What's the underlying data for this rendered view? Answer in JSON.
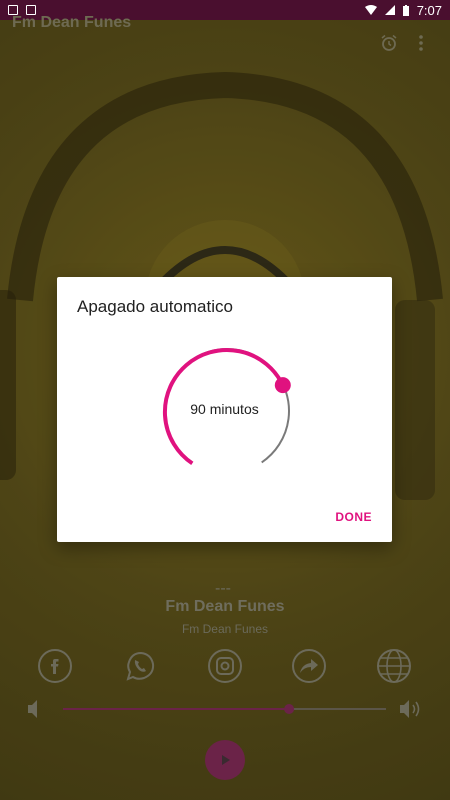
{
  "status_bar": {
    "time": "7:07",
    "left_icons": [
      "image-icon",
      "a-icon"
    ],
    "right_icons": [
      "wifi-icon",
      "signal-icon",
      "battery-icon"
    ]
  },
  "app_bar": {
    "title": "Fm Dean Funes",
    "actions": [
      "alarm-icon",
      "more-vert-icon"
    ]
  },
  "player": {
    "dash": "---",
    "title": "Fm Dean Funes",
    "subtitle": "Fm Dean Funes",
    "social": [
      "facebook-icon",
      "whatsapp-icon",
      "instagram-icon",
      "share-icon",
      "globe-icon"
    ],
    "volume_level": 0.7,
    "play_icon": "play-icon"
  },
  "dialog": {
    "title": "Apagado automatico",
    "value_label": "90 minutos",
    "progress_fraction": 0.72,
    "done_label": "DONE",
    "accent": "#e0127f"
  }
}
